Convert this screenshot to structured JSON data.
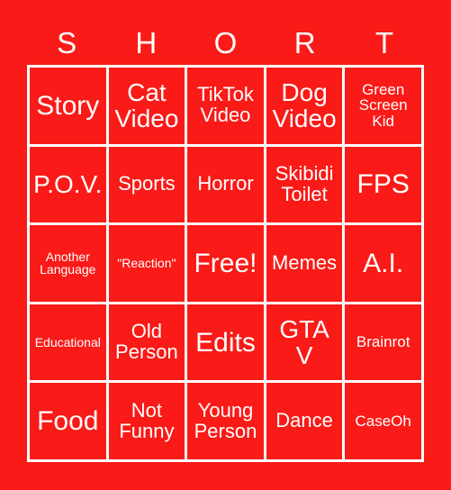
{
  "card": {
    "title_letters": [
      "S",
      "H",
      "O",
      "R",
      "T"
    ],
    "background_color": "#FA1A17",
    "border_color": "#FFFFFF",
    "text_color": "#FFFFFF",
    "rows": [
      [
        {
          "label": "Story",
          "size": "fs-xl"
        },
        {
          "label": "Cat\nVideo",
          "size": "fs-lg"
        },
        {
          "label": "TikTok\nVideo",
          "size": "fs-md"
        },
        {
          "label": "Dog\nVideo",
          "size": "fs-lg"
        },
        {
          "label": "Green\nScreen\nKid",
          "size": "fs-sm"
        }
      ],
      [
        {
          "label": "P.O.V.",
          "size": "fs-lg"
        },
        {
          "label": "Sports",
          "size": "fs-md"
        },
        {
          "label": "Horror",
          "size": "fs-md"
        },
        {
          "label": "Skibidi\nToilet",
          "size": "fs-md"
        },
        {
          "label": "FPS",
          "size": "fs-xl"
        }
      ],
      [
        {
          "label": "Another\nLanguage",
          "size": "fs-xs"
        },
        {
          "label": "\"Reaction\"",
          "size": "fs-xs"
        },
        {
          "label": "Free!",
          "size": "fs-xl"
        },
        {
          "label": "Memes",
          "size": "fs-md"
        },
        {
          "label": "A.I.",
          "size": "fs-xl"
        }
      ],
      [
        {
          "label": "Educational",
          "size": "fs-xs"
        },
        {
          "label": "Old\nPerson",
          "size": "fs-md"
        },
        {
          "label": "Edits",
          "size": "fs-xl"
        },
        {
          "label": "GTA\nV",
          "size": "fs-lg"
        },
        {
          "label": "Brainrot",
          "size": "fs-sm"
        }
      ],
      [
        {
          "label": "Food",
          "size": "fs-xl"
        },
        {
          "label": "Not\nFunny",
          "size": "fs-md"
        },
        {
          "label": "Young\nPerson",
          "size": "fs-md"
        },
        {
          "label": "Dance",
          "size": "fs-md"
        },
        {
          "label": "CaseOh",
          "size": "fs-sm"
        }
      ]
    ]
  }
}
